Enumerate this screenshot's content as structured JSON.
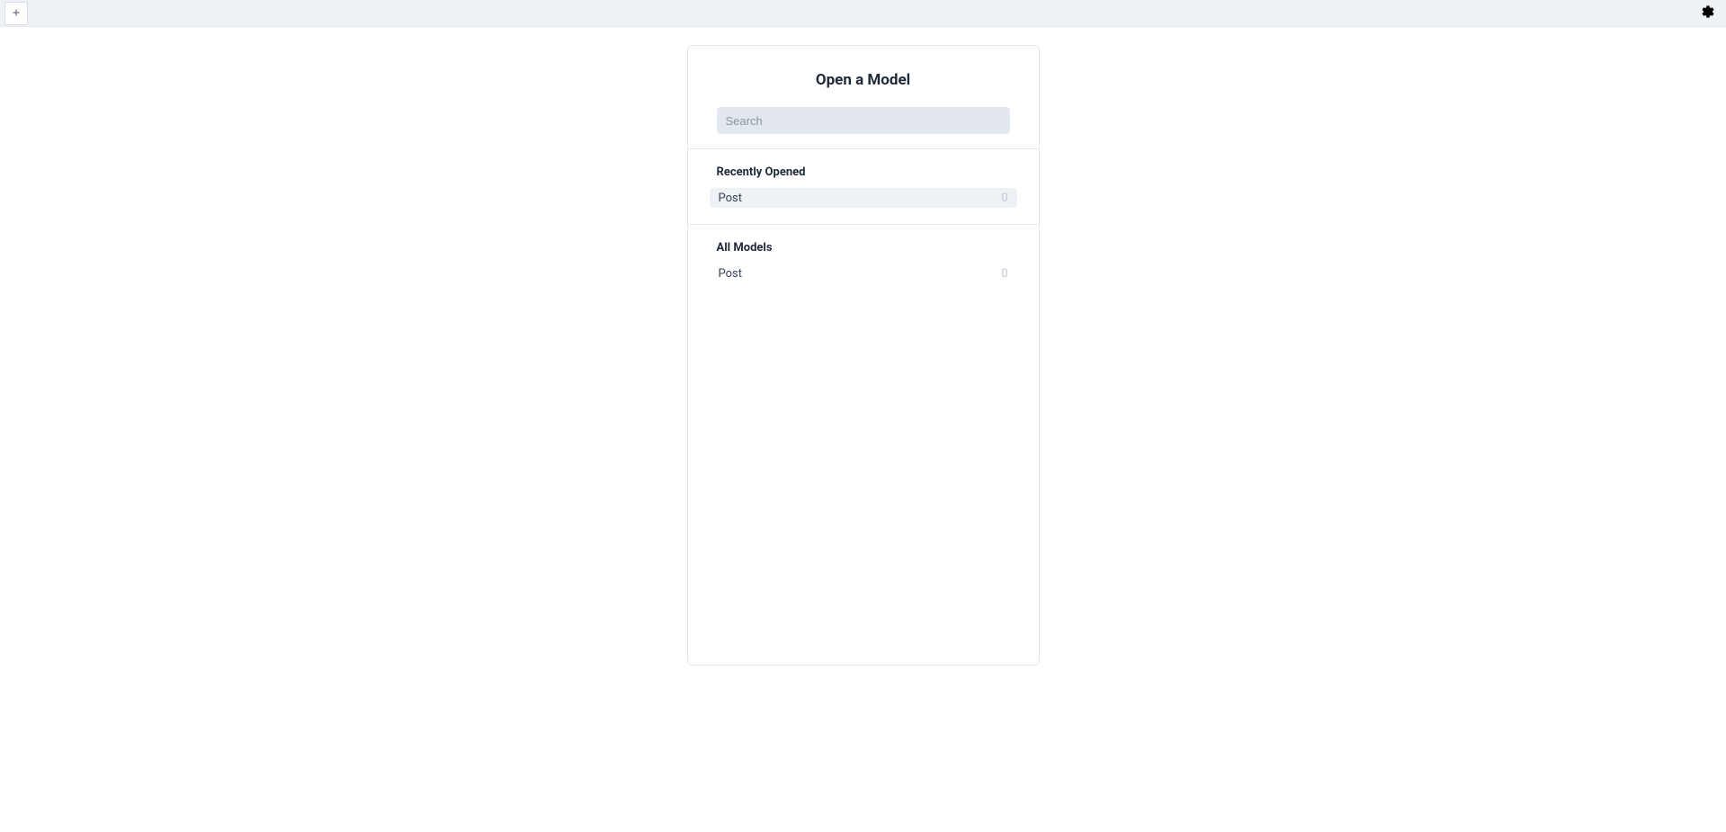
{
  "modal": {
    "title": "Open a Model",
    "search_placeholder": "Search",
    "sections": {
      "recent": {
        "title": "Recently Opened",
        "item_name": "Post",
        "item_count": "0"
      },
      "all": {
        "title": "All Models",
        "item_name": "Post",
        "item_count": "0"
      }
    }
  }
}
